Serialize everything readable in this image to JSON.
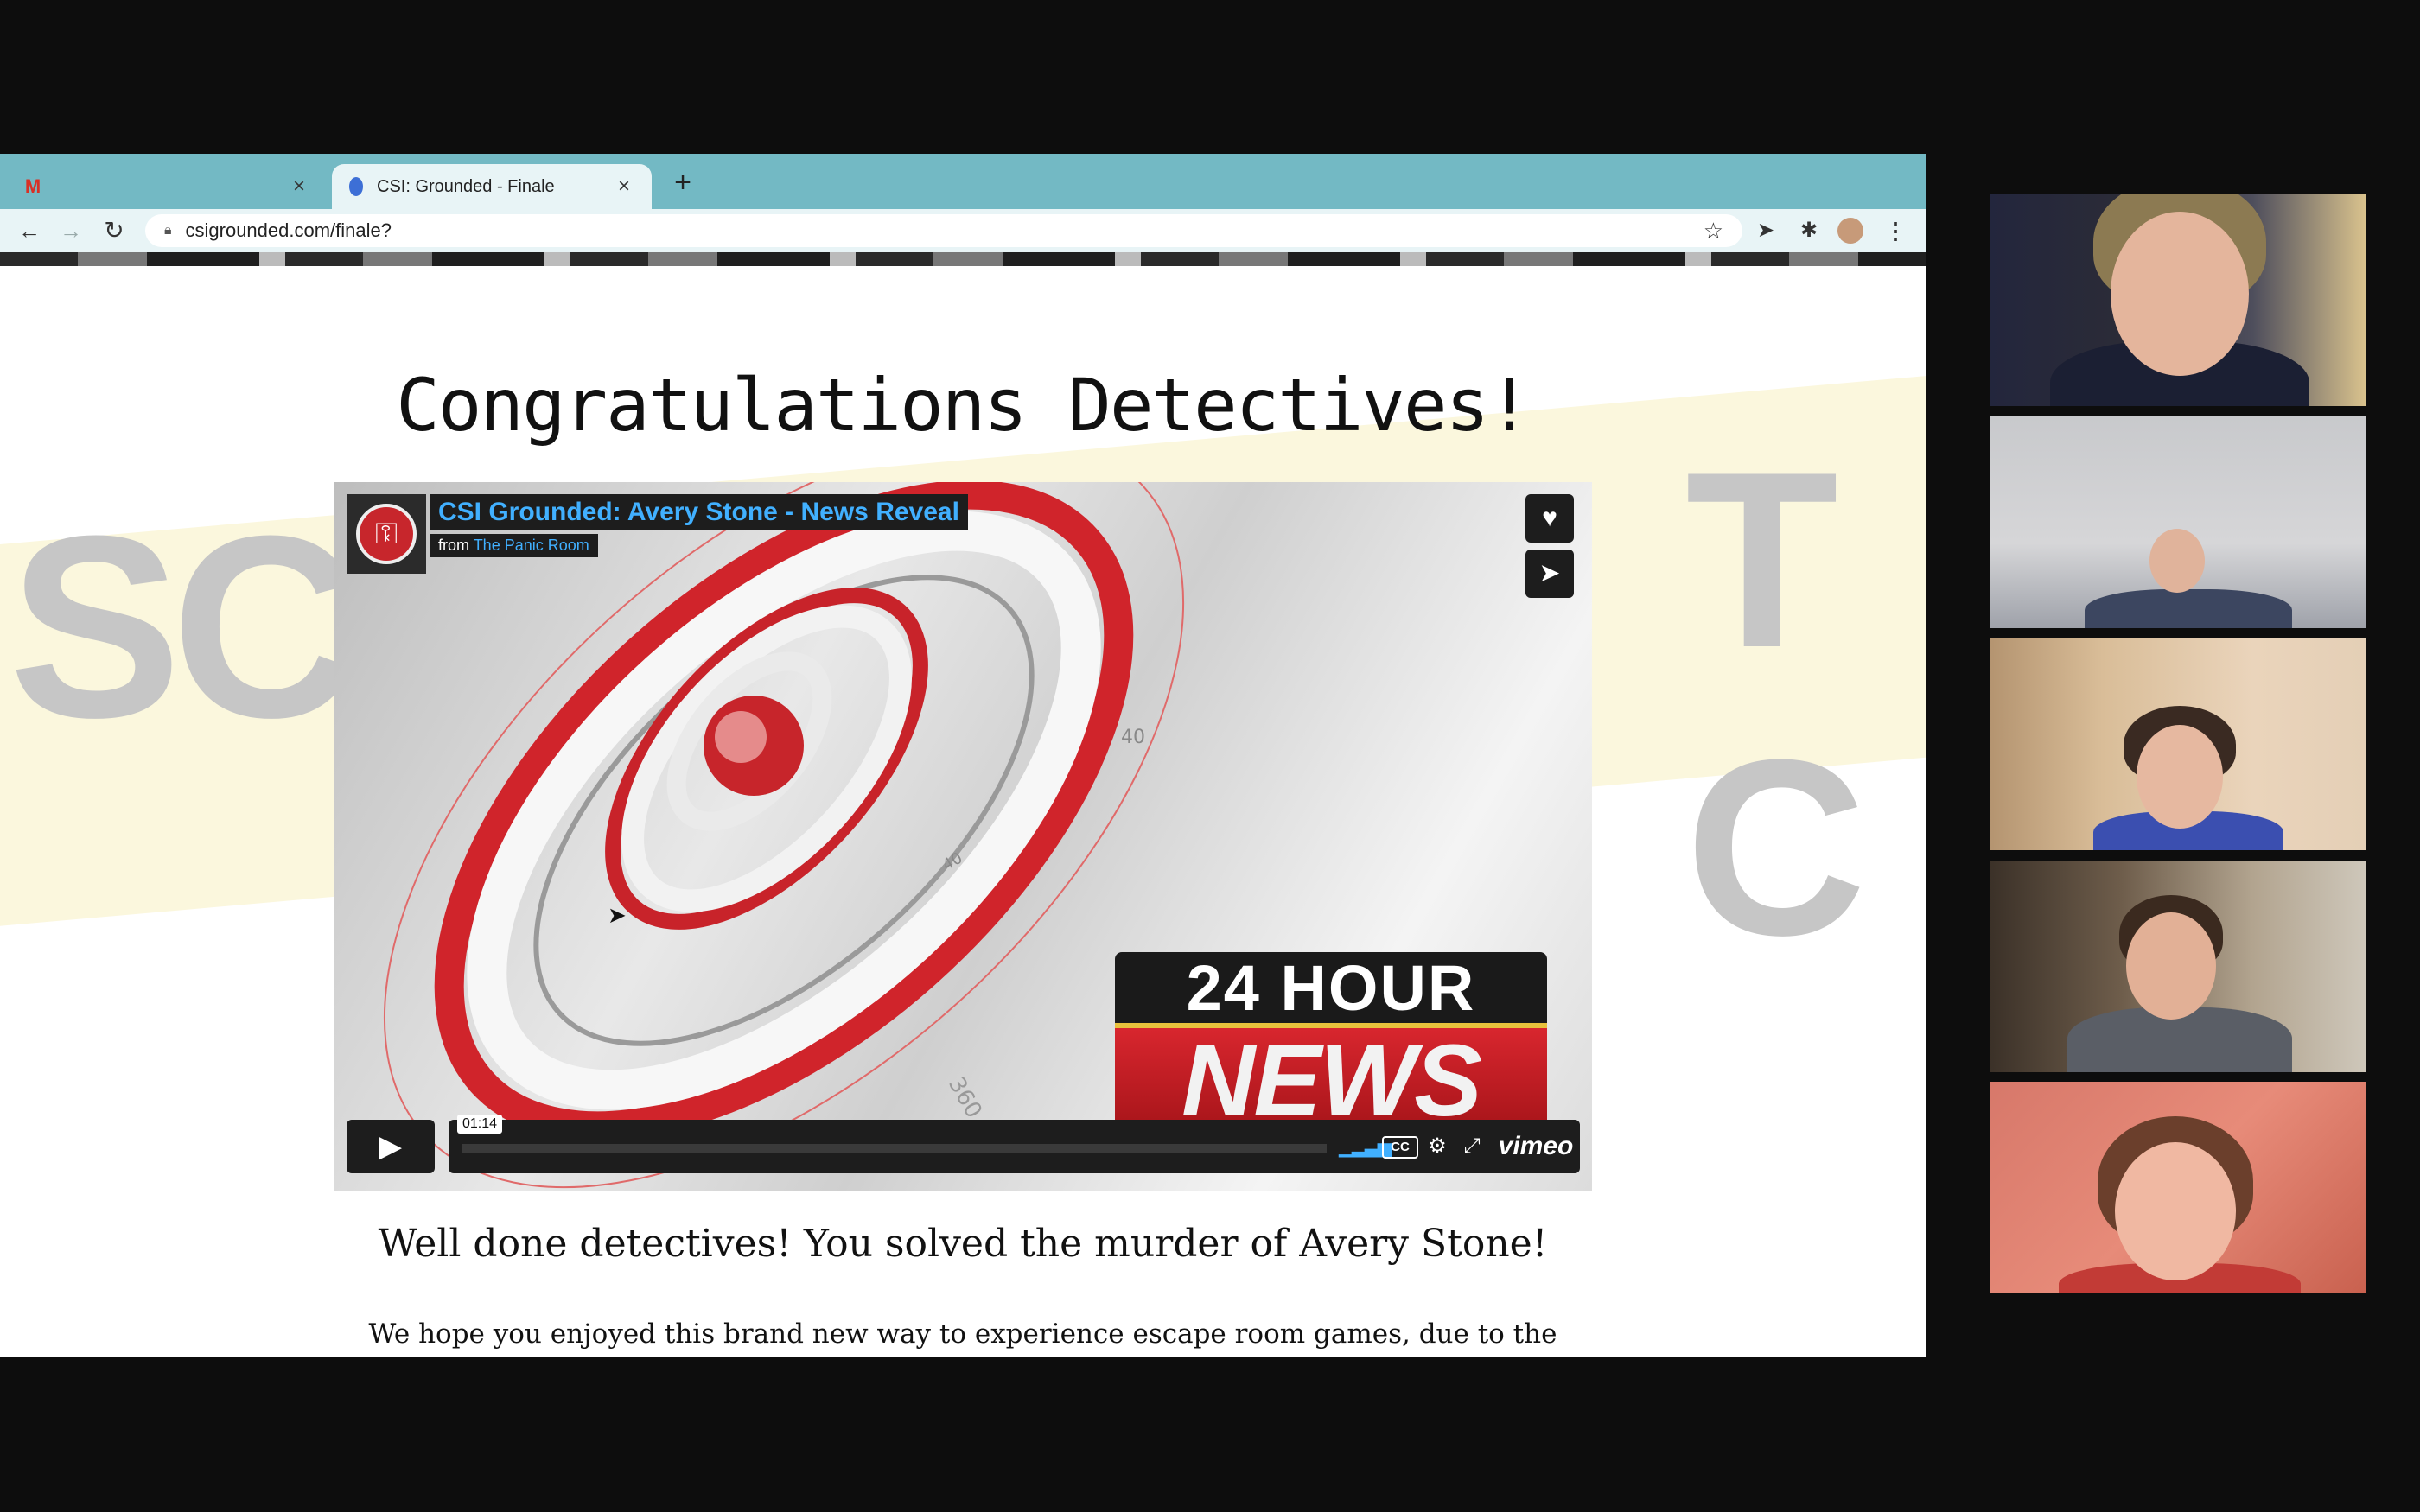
{
  "browser": {
    "tabs": [
      {
        "label": "",
        "icon": "gmail-icon",
        "active": false
      },
      {
        "label": "CSI: Grounded - Finale",
        "icon": "site-favicon-icon",
        "active": true
      }
    ],
    "url": "csigrounded.com/finale?"
  },
  "page": {
    "heading": "Congratulations Detectives!",
    "subheading": "Well done detectives! You solved the murder of Avery Stone!",
    "body_text": "We hope you enjoyed this brand new way to experience escape room games, due to the"
  },
  "video": {
    "title": "CSI Grounded: Avery Stone - News Reveal",
    "from_label": "from",
    "channel": "The Panic Room",
    "time": "01:14",
    "brand": "vimeo",
    "cc_label": "CC",
    "news_logo": {
      "top": "24 HOUR",
      "bottom": "NEWS"
    },
    "progress_fraction": 0.0,
    "dial_labels": [
      "40",
      "40",
      "360"
    ]
  },
  "participants": [
    {
      "id": "participant-1"
    },
    {
      "id": "participant-2"
    },
    {
      "id": "participant-3"
    },
    {
      "id": "participant-4"
    },
    {
      "id": "participant-5"
    }
  ],
  "colors": {
    "tabstrip": "#73b9c4",
    "link_blue": "#41b0ff",
    "news_red": "#d8262e"
  }
}
